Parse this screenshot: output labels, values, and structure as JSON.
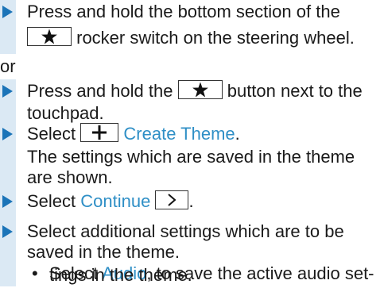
{
  "steps": {
    "s1_line1": "Press and hold the bottom section of the",
    "s1_line2": "rocker switch on the steering wheel.",
    "or": "or",
    "s2_line1a": "Press and hold the",
    "s2_line1b": "button next to the",
    "s2_line2": "touchpad.",
    "s3_select": "Select",
    "s3_link": "Create Theme",
    "s3_period": ".",
    "s3_result_line1": "The settings which are saved in the theme",
    "s3_result_line2": "are shown.",
    "s4_select": "Select",
    "s4_link": "Continue",
    "s4_period": ".",
    "s5_line1": "Select additional settings which are to be",
    "s5_line2": "saved in the theme.",
    "sub_bullet": "•",
    "sub_select": "Select",
    "sub_link": "Audio",
    "sub_rest": ", to save the active audio set-",
    "sub_line2": "tings in the theme."
  },
  "icons": {
    "favorite": "star-icon",
    "add": "plus-icon",
    "continue": "chevron-right-icon"
  },
  "colors": {
    "accent_blue": "#1b74b8",
    "link_blue": "#2f8fc6",
    "bar_bg": "#dbe9f4"
  }
}
